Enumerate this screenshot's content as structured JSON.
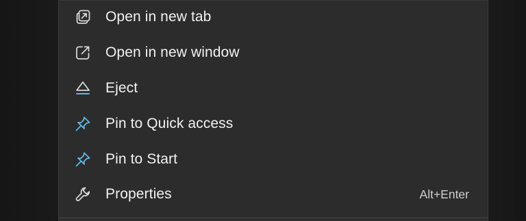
{
  "menu": {
    "items": [
      {
        "label": "Open in new tab",
        "icon": "open-in-new-tab-icon",
        "shortcut": ""
      },
      {
        "label": "Open in new window",
        "icon": "open-in-new-window-icon",
        "shortcut": ""
      },
      {
        "label": "Eject",
        "icon": "eject-icon",
        "shortcut": ""
      },
      {
        "label": "Pin to Quick access",
        "icon": "pin-icon",
        "shortcut": ""
      },
      {
        "label": "Pin to Start",
        "icon": "pin-icon",
        "shortcut": ""
      },
      {
        "label": "Properties",
        "icon": "wrench-icon",
        "shortcut": "Alt+Enter"
      }
    ]
  },
  "colors": {
    "menu_background": "#2c2c2c",
    "text": "#f2f2f2",
    "icon_stroke": "#d6d6d6",
    "accent_blue": "#5fb8e8"
  }
}
